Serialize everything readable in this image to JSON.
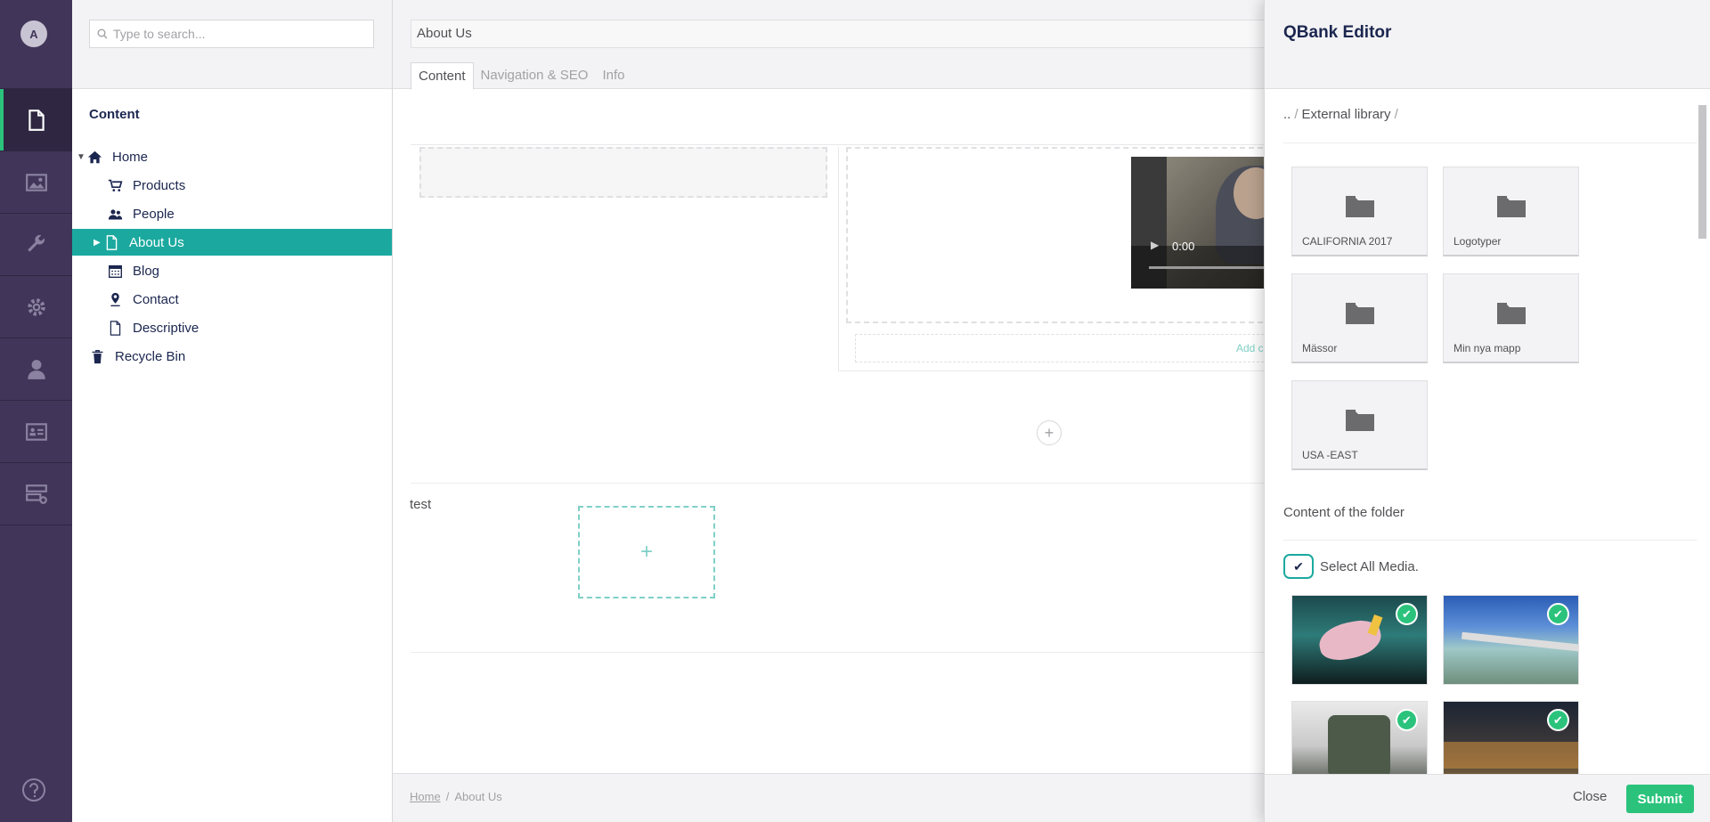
{
  "user": {
    "avatar_initial": "A"
  },
  "sections": [
    {
      "icon": "document-icon"
    },
    {
      "icon": "image-icon"
    },
    {
      "icon": "wrench-icon"
    },
    {
      "icon": "gear-icon"
    },
    {
      "icon": "user-icon"
    },
    {
      "icon": "id-card-icon"
    },
    {
      "icon": "forms-icon"
    }
  ],
  "search": {
    "placeholder": "Type to search..."
  },
  "tree": {
    "title": "Content",
    "items": [
      {
        "label": "Home",
        "icon": "home-icon"
      },
      {
        "label": "Products",
        "icon": "cart-icon"
      },
      {
        "label": "People",
        "icon": "people-icon"
      },
      {
        "label": "About Us",
        "icon": "document-icon"
      },
      {
        "label": "Blog",
        "icon": "calendar-icon"
      },
      {
        "label": "Contact",
        "icon": "map-pin-icon"
      },
      {
        "label": "Descriptive",
        "icon": "document-icon"
      },
      {
        "label": "Recycle Bin",
        "icon": "trash-icon"
      }
    ]
  },
  "editor": {
    "name_value": "About Us",
    "tabs": [
      "Content",
      "Navigation & SEO",
      "Info"
    ],
    "video_time": "0:00",
    "add_content_label": "Add c",
    "add_row_symbol": "+",
    "row_label": "test",
    "empty_cell_symbol": "+",
    "breadcrumb": {
      "home": "Home",
      "separator": "/",
      "current": "About Us"
    }
  },
  "qbank": {
    "title": "QBank Editor",
    "breadcrumb": {
      "up": "..",
      "separator": "/",
      "folder": "External library"
    },
    "folders": [
      "CALIFORNIA 2017",
      "Logotyper",
      "Mässor",
      "Min nya mapp",
      "USA -EAST"
    ],
    "content_title": "Content of the folder",
    "select_all_label": "Select All Media.",
    "media_selected": [
      true,
      true,
      true,
      true
    ],
    "close_label": "Close",
    "submit_label": "Submit",
    "accent_color": "#2bc37c"
  }
}
